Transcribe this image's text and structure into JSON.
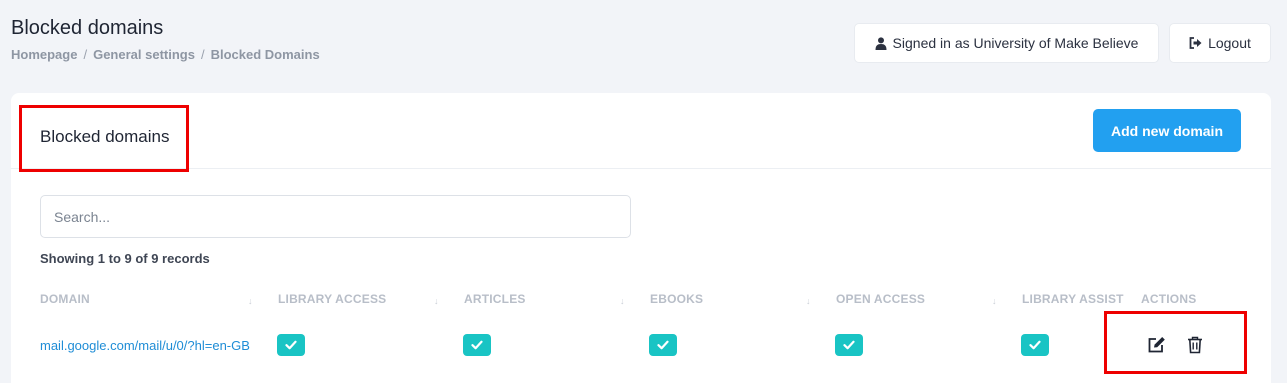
{
  "header": {
    "title": "Blocked domains",
    "breadcrumb": [
      "Homepage",
      "General settings",
      "Blocked Domains"
    ],
    "breadcrumb_sep": "/",
    "signed_in_label": "Signed in as University of Make Believe",
    "logout_label": "Logout"
  },
  "card": {
    "title": "Blocked domains",
    "add_button": "Add new domain",
    "search_placeholder": "Search...",
    "records_text": "Showing 1 to 9 of 9 records"
  },
  "table": {
    "columns": [
      "DOMAIN",
      "LIBRARY ACCESS",
      "ARTICLES",
      "EBOOKS",
      "OPEN ACCESS",
      "LIBRARY ASSIST",
      "ACTIONS"
    ],
    "rows": [
      {
        "domain": "mail.google.com/mail/u/0/?hl=en-GB",
        "library_access": true,
        "articles": true,
        "ebooks": true,
        "open_access": true,
        "library_assist": true
      }
    ]
  },
  "colors": {
    "accent": "#22a0f0",
    "check": "#19c4c4",
    "link": "#1f8dd6",
    "highlight": "#ee0000"
  },
  "icons": [
    "user-icon",
    "logout-icon",
    "check-icon",
    "edit-icon",
    "trash-icon",
    "sort-icon"
  ]
}
